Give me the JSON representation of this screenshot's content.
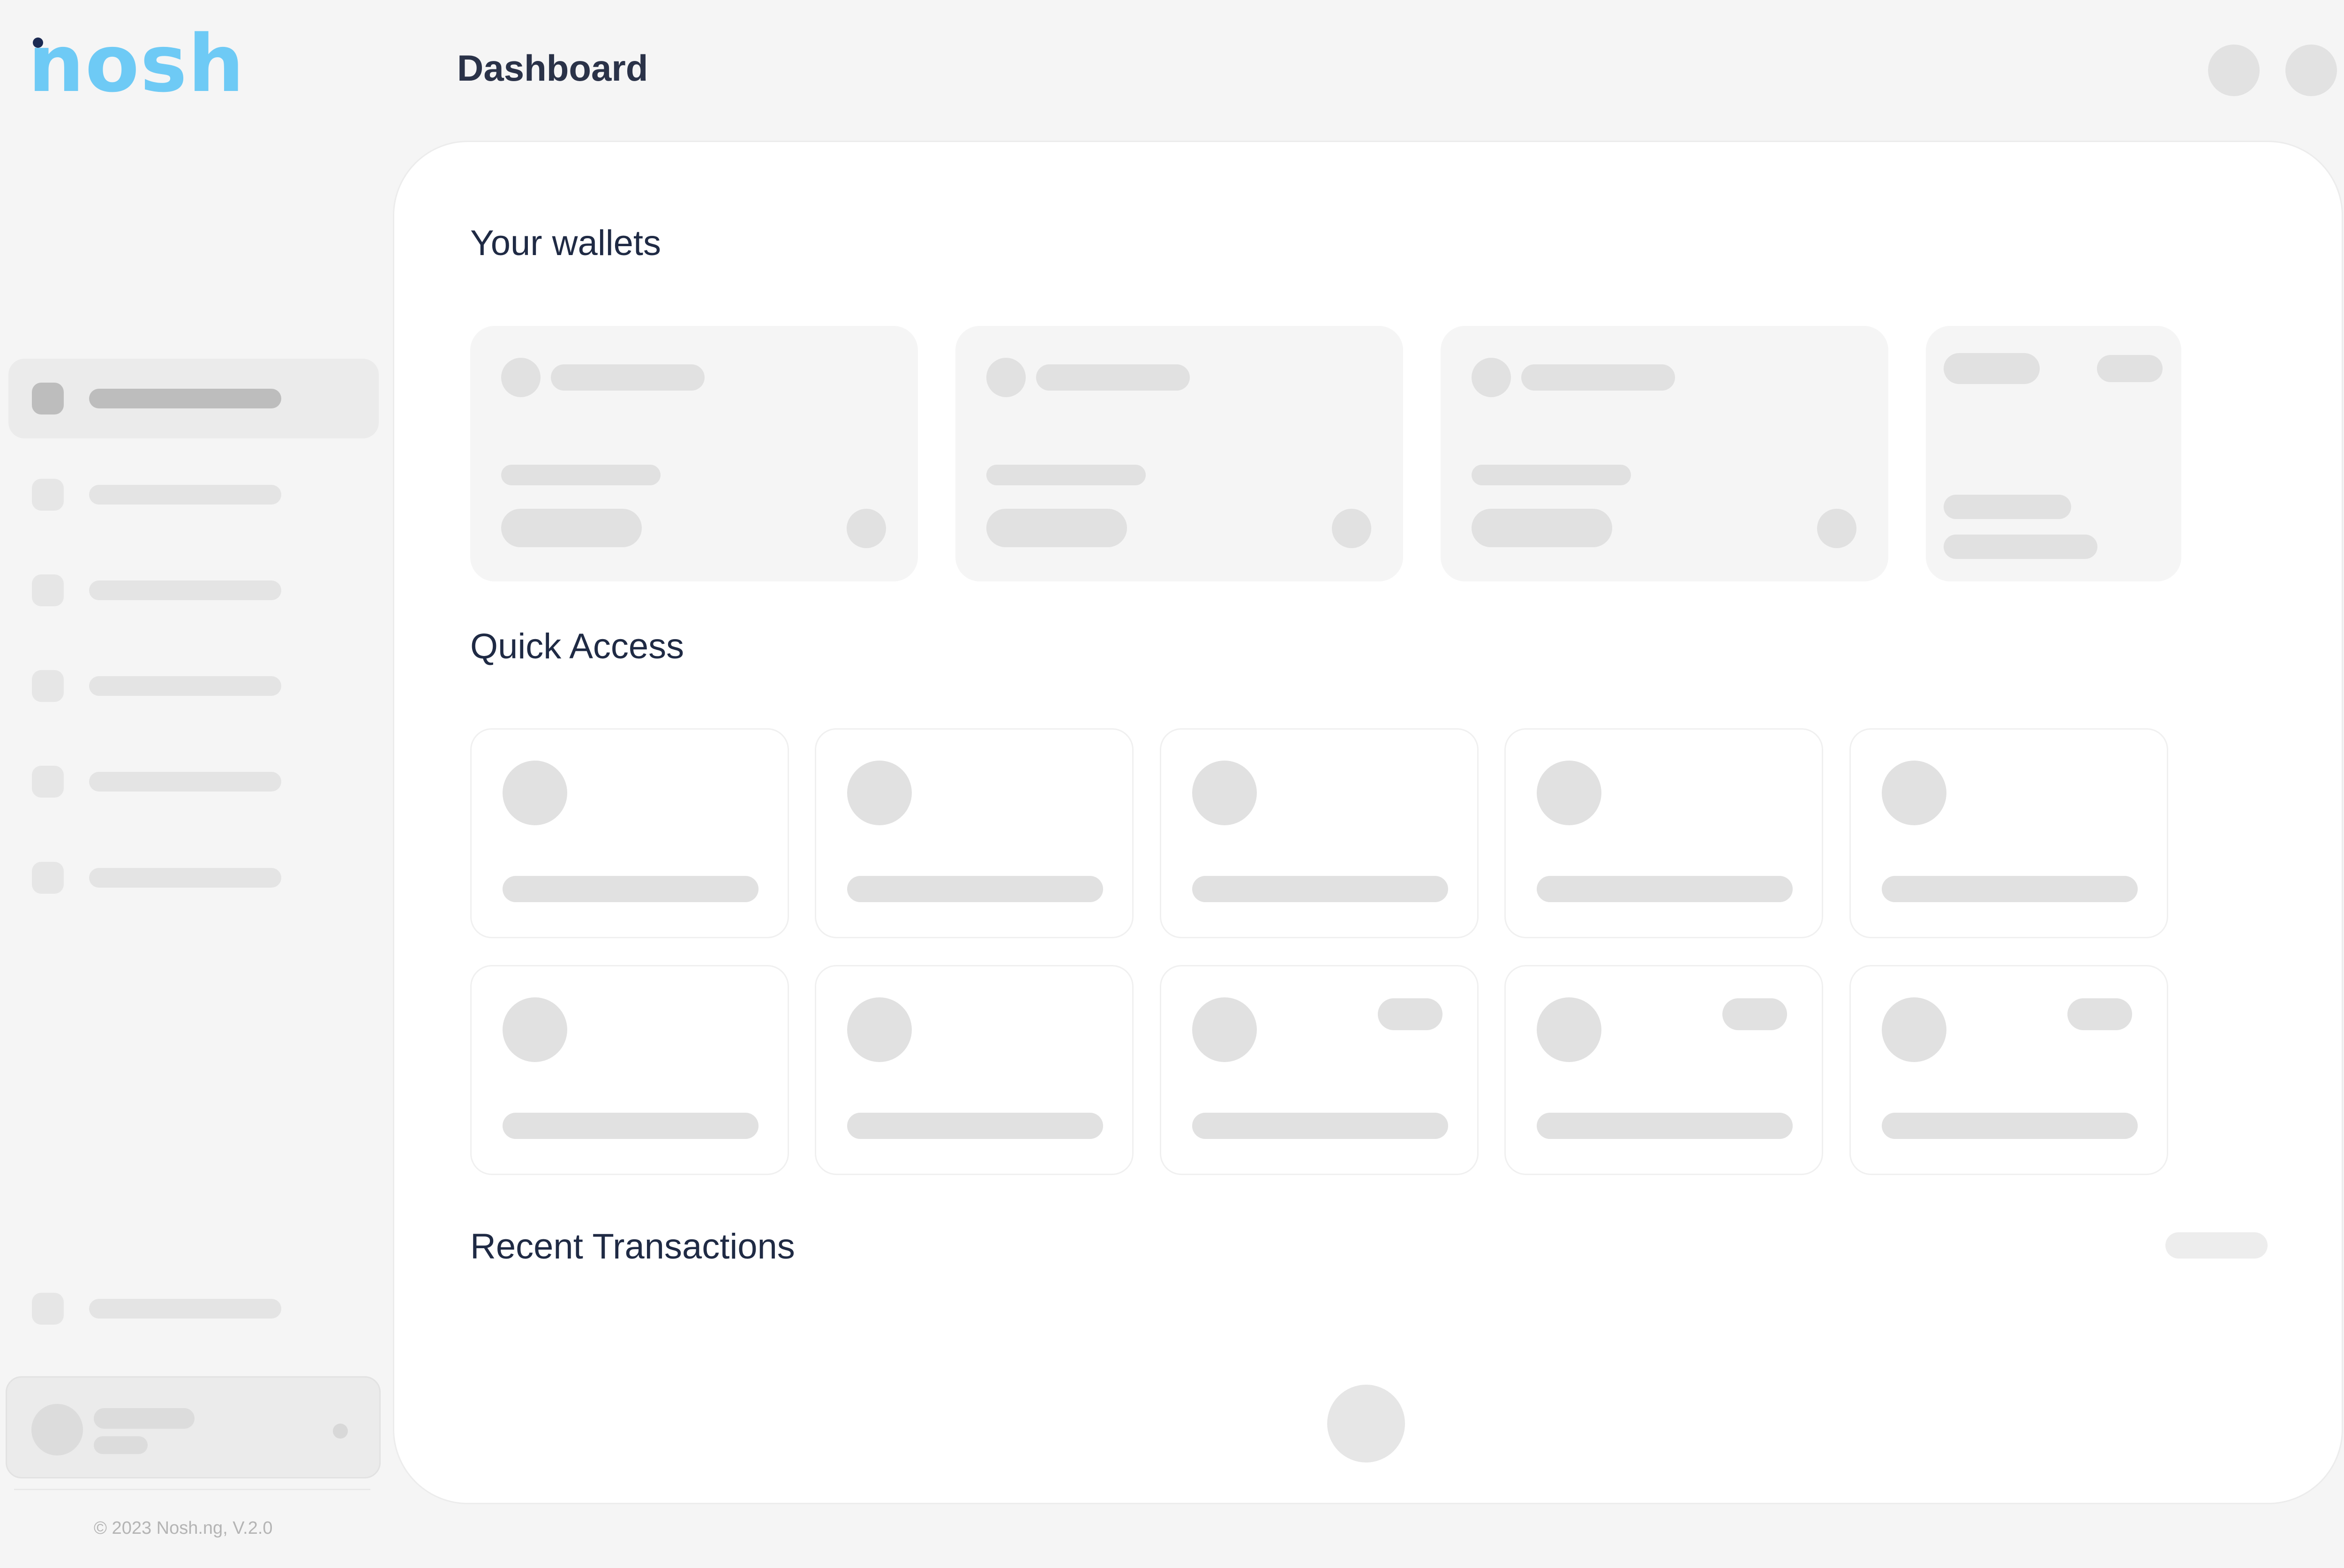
{
  "brand": {
    "logo_text": "nosh",
    "logo_color": "#6ecaf5"
  },
  "header": {
    "title": "Dashboard",
    "actions": [
      "notification-button",
      "profile-button"
    ]
  },
  "sidebar": {
    "nav_item_count": 7,
    "active_index": 0,
    "footer": {
      "copyright": "© 2023 Nosh.ng, V.2.0"
    }
  },
  "main": {
    "wallets": {
      "title": "Your wallets"
    },
    "quick_access": {
      "title": "Quick Access"
    },
    "recent_transactions": {
      "title": "Recent Transactions"
    }
  },
  "state": "loading-skeleton"
}
